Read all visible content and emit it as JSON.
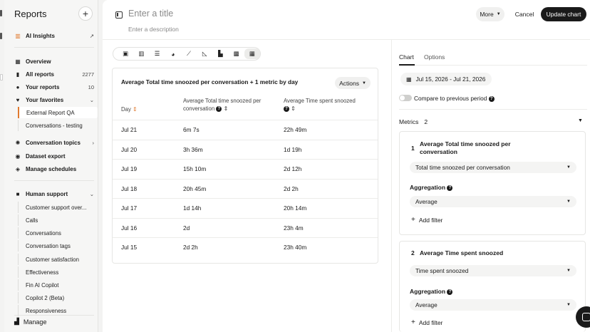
{
  "sidebar": {
    "title": "Reports",
    "plus": "+",
    "ai_insights": "AI Insights",
    "overview": "Overview",
    "all_reports": "All reports",
    "all_reports_count": "2277",
    "your_reports": "Your reports",
    "your_reports_count": "10",
    "your_favorites": "Your favorites",
    "favorites": [
      "External Report QA",
      "Conversations - testing"
    ],
    "conversation_topics": "Conversation topics",
    "dataset_export": "Dataset export",
    "manage_schedules": "Manage schedules",
    "human_support": "Human support",
    "human_support_items": [
      "Customer support over...",
      "Calls",
      "Conversations",
      "Conversation tags",
      "Customer satisfaction",
      "Effectiveness",
      "Fin AI Copilot",
      "Copilot 2 (Beta)",
      "Responsiveness"
    ],
    "manage": "Manage"
  },
  "header": {
    "title_placeholder": "Enter a title",
    "description_placeholder": "Enter a description",
    "more": "More",
    "cancel": "Cancel",
    "update": "Update chart"
  },
  "table": {
    "title": "Average Total time snoozed per conversation + 1 metric by day",
    "actions": "Actions",
    "col_day": "Day",
    "col_m1_line1": "Average Total time snoozed per",
    "col_m1_line2": "conversation",
    "col_m2": "Average Time spent snoozed",
    "rows": [
      {
        "day": "Jul 21",
        "m1": "6m 7s",
        "m2": "22h 49m"
      },
      {
        "day": "Jul 20",
        "m1": "3h 36m",
        "m2": "1d 19h"
      },
      {
        "day": "Jul 19",
        "m1": "15h 10m",
        "m2": "2d 12h"
      },
      {
        "day": "Jul 18",
        "m1": "20h 45m",
        "m2": "2d 2h"
      },
      {
        "day": "Jul 17",
        "m1": "1d 14h",
        "m2": "20h 14m"
      },
      {
        "day": "Jul 16",
        "m1": "2d",
        "m2": "23h 4m"
      },
      {
        "day": "Jul 15",
        "m1": "2d 2h",
        "m2": "23h 40m"
      }
    ]
  },
  "panel": {
    "tab_chart": "Chart",
    "tab_options": "Options",
    "date_range": "Jul 15, 2026 - Jul 21, 2026",
    "compare": "Compare to previous period",
    "metrics_label": "Metrics",
    "metrics_count": "2",
    "metric1": {
      "num": "1",
      "title": "Average Total time snoozed per conversation",
      "select": "Total time snoozed per conversation",
      "agg_label": "Aggregation",
      "agg_value": "Average",
      "add_filter": "Add filter"
    },
    "metric2": {
      "num": "2",
      "title": "Average Time spent snoozed",
      "select": "Time spent snoozed",
      "agg_label": "Aggregation",
      "agg_value": "Average",
      "add_filter": "Add filter"
    }
  },
  "colors": {
    "accent": "#e07a2f",
    "primary_button": "#1a1a1a"
  }
}
